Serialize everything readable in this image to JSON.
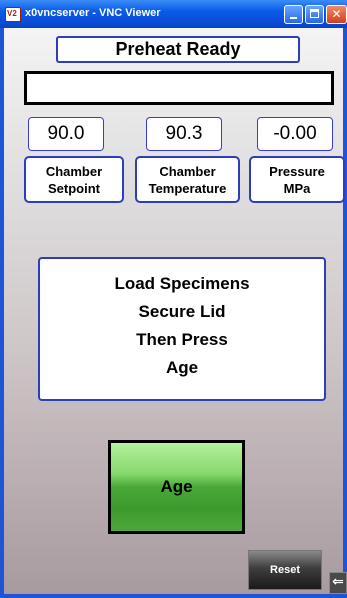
{
  "window": {
    "title": "x0vncserver - VNC Viewer",
    "icon": "vnc-app-icon",
    "buttons": [
      "minimize-icon",
      "maximize-icon",
      "close-icon"
    ]
  },
  "status_text": "Preheat Ready",
  "message_text": "",
  "readouts": [
    {
      "value": "90.0",
      "label_line1": "Chamber",
      "label_line2": "Setpoint"
    },
    {
      "value": "90.3",
      "label_line1": "Chamber",
      "label_line2": "Temperature"
    },
    {
      "value": "-0.00",
      "label_line1": "Pressure",
      "label_line2": "MPa"
    }
  ],
  "instructions": [
    "Load Specimens",
    "Secure Lid",
    "Then Press",
    "Age"
  ],
  "age_button_label": "Age",
  "reset_button_label": "Reset",
  "colors": {
    "titlebar": "#0a5be8",
    "border_blue": "#2d3dbc",
    "age_button_green": "#4aa838",
    "reset_button": "#1a1a1a"
  }
}
